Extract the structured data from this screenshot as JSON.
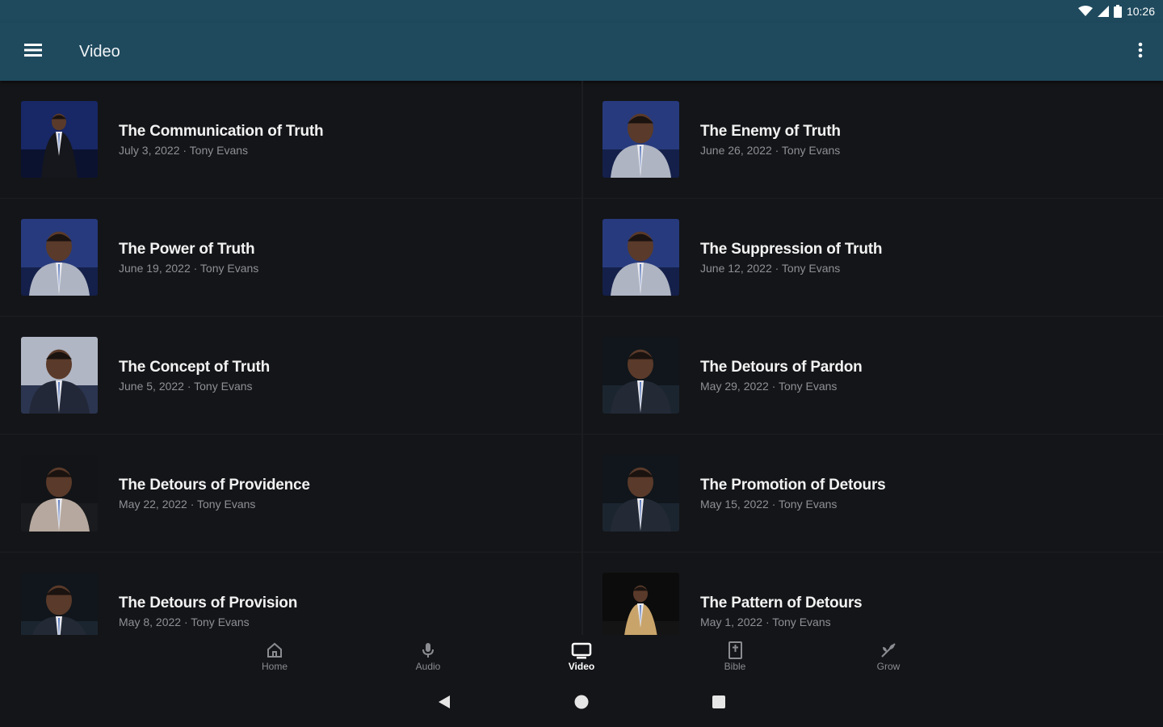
{
  "status": {
    "time": "10:26"
  },
  "appbar": {
    "title": "Video"
  },
  "videos": [
    {
      "title": "The Communication of Truth",
      "subtitle": "July 3, 2022 · Tony Evans",
      "thumb": "speaker-stage-blue"
    },
    {
      "title": "The Enemy of Truth",
      "subtitle": "June 26, 2022 · Tony Evans",
      "thumb": "speaker-closeup-blue"
    },
    {
      "title": "The Power of Truth",
      "subtitle": "June 19, 2022 · Tony Evans",
      "thumb": "speaker-closeup-blue"
    },
    {
      "title": "The Suppression of Truth",
      "subtitle": "June 12, 2022 · Tony Evans",
      "thumb": "speaker-closeup-blue"
    },
    {
      "title": "The Concept of Truth",
      "subtitle": "June 5, 2022 · Tony Evans",
      "thumb": "speaker-closeup-gray"
    },
    {
      "title": "The Detours of Pardon",
      "subtitle": "May 29, 2022 · Tony Evans",
      "thumb": "speaker-closeup-dark"
    },
    {
      "title": "The Detours of Providence",
      "subtitle": "May 22, 2022 · Tony Evans",
      "thumb": "speaker-profile-dark"
    },
    {
      "title": "The Promotion of Detours",
      "subtitle": "May 15, 2022 · Tony Evans",
      "thumb": "speaker-closeup-dark"
    },
    {
      "title": "The Detours of Provision",
      "subtitle": "May 8, 2022 · Tony Evans",
      "thumb": "speaker-closeup-dark"
    },
    {
      "title": "The Pattern of Detours",
      "subtitle": "May 1, 2022 · Tony Evans",
      "thumb": "speaker-gold-jacket"
    }
  ],
  "bottom_nav": [
    {
      "label": "Home",
      "icon": "home-icon",
      "active": false
    },
    {
      "label": "Audio",
      "icon": "microphone-icon",
      "active": false
    },
    {
      "label": "Video",
      "icon": "tv-icon",
      "active": true
    },
    {
      "label": "Bible",
      "icon": "bible-icon",
      "active": false
    },
    {
      "label": "Grow",
      "icon": "grow-icon",
      "active": false
    }
  ],
  "colors": {
    "appbar": "#1f4a5e",
    "background": "#141518",
    "subtitle": "#8e9096"
  }
}
